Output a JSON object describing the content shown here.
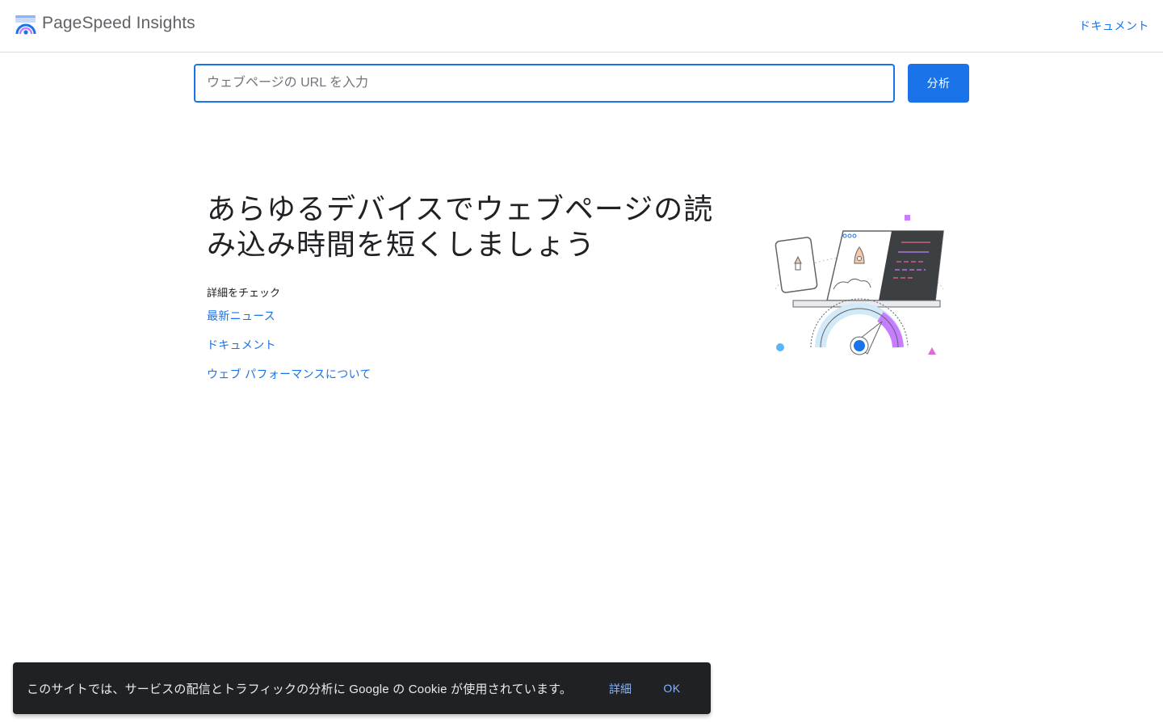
{
  "header": {
    "product_name": "PageSpeed Insights",
    "docs_link": "ドキュメント"
  },
  "search": {
    "placeholder": "ウェブページの URL を入力",
    "value": "",
    "analyze_label": "分析"
  },
  "hero": {
    "title": "あらゆるデバイスでウェブページの読み込み時間を短くしましょう",
    "learn_more_heading": "詳細をチェック",
    "links": [
      {
        "label": "最新ニュース"
      },
      {
        "label": "ドキュメント"
      },
      {
        "label": "ウェブ パフォーマンスについて"
      }
    ]
  },
  "cookie_notice": {
    "text": "このサイトでは、サービスの配信とトラフィックの分析に Google の Cookie が使用されています。",
    "details_label": "詳細",
    "ok_label": "OK"
  },
  "colors": {
    "accent": "#1a73e8",
    "cookie_bg": "#202124",
    "cookie_link": "#8ab4f8",
    "gauge_purple": "#c77dff",
    "gauge_light": "#d2e9f7",
    "gauge_dot": "#1a73e8"
  },
  "icons": {
    "logo": "pagespeed-gauge-icon",
    "illustration": "rocket-speed-illustration"
  }
}
